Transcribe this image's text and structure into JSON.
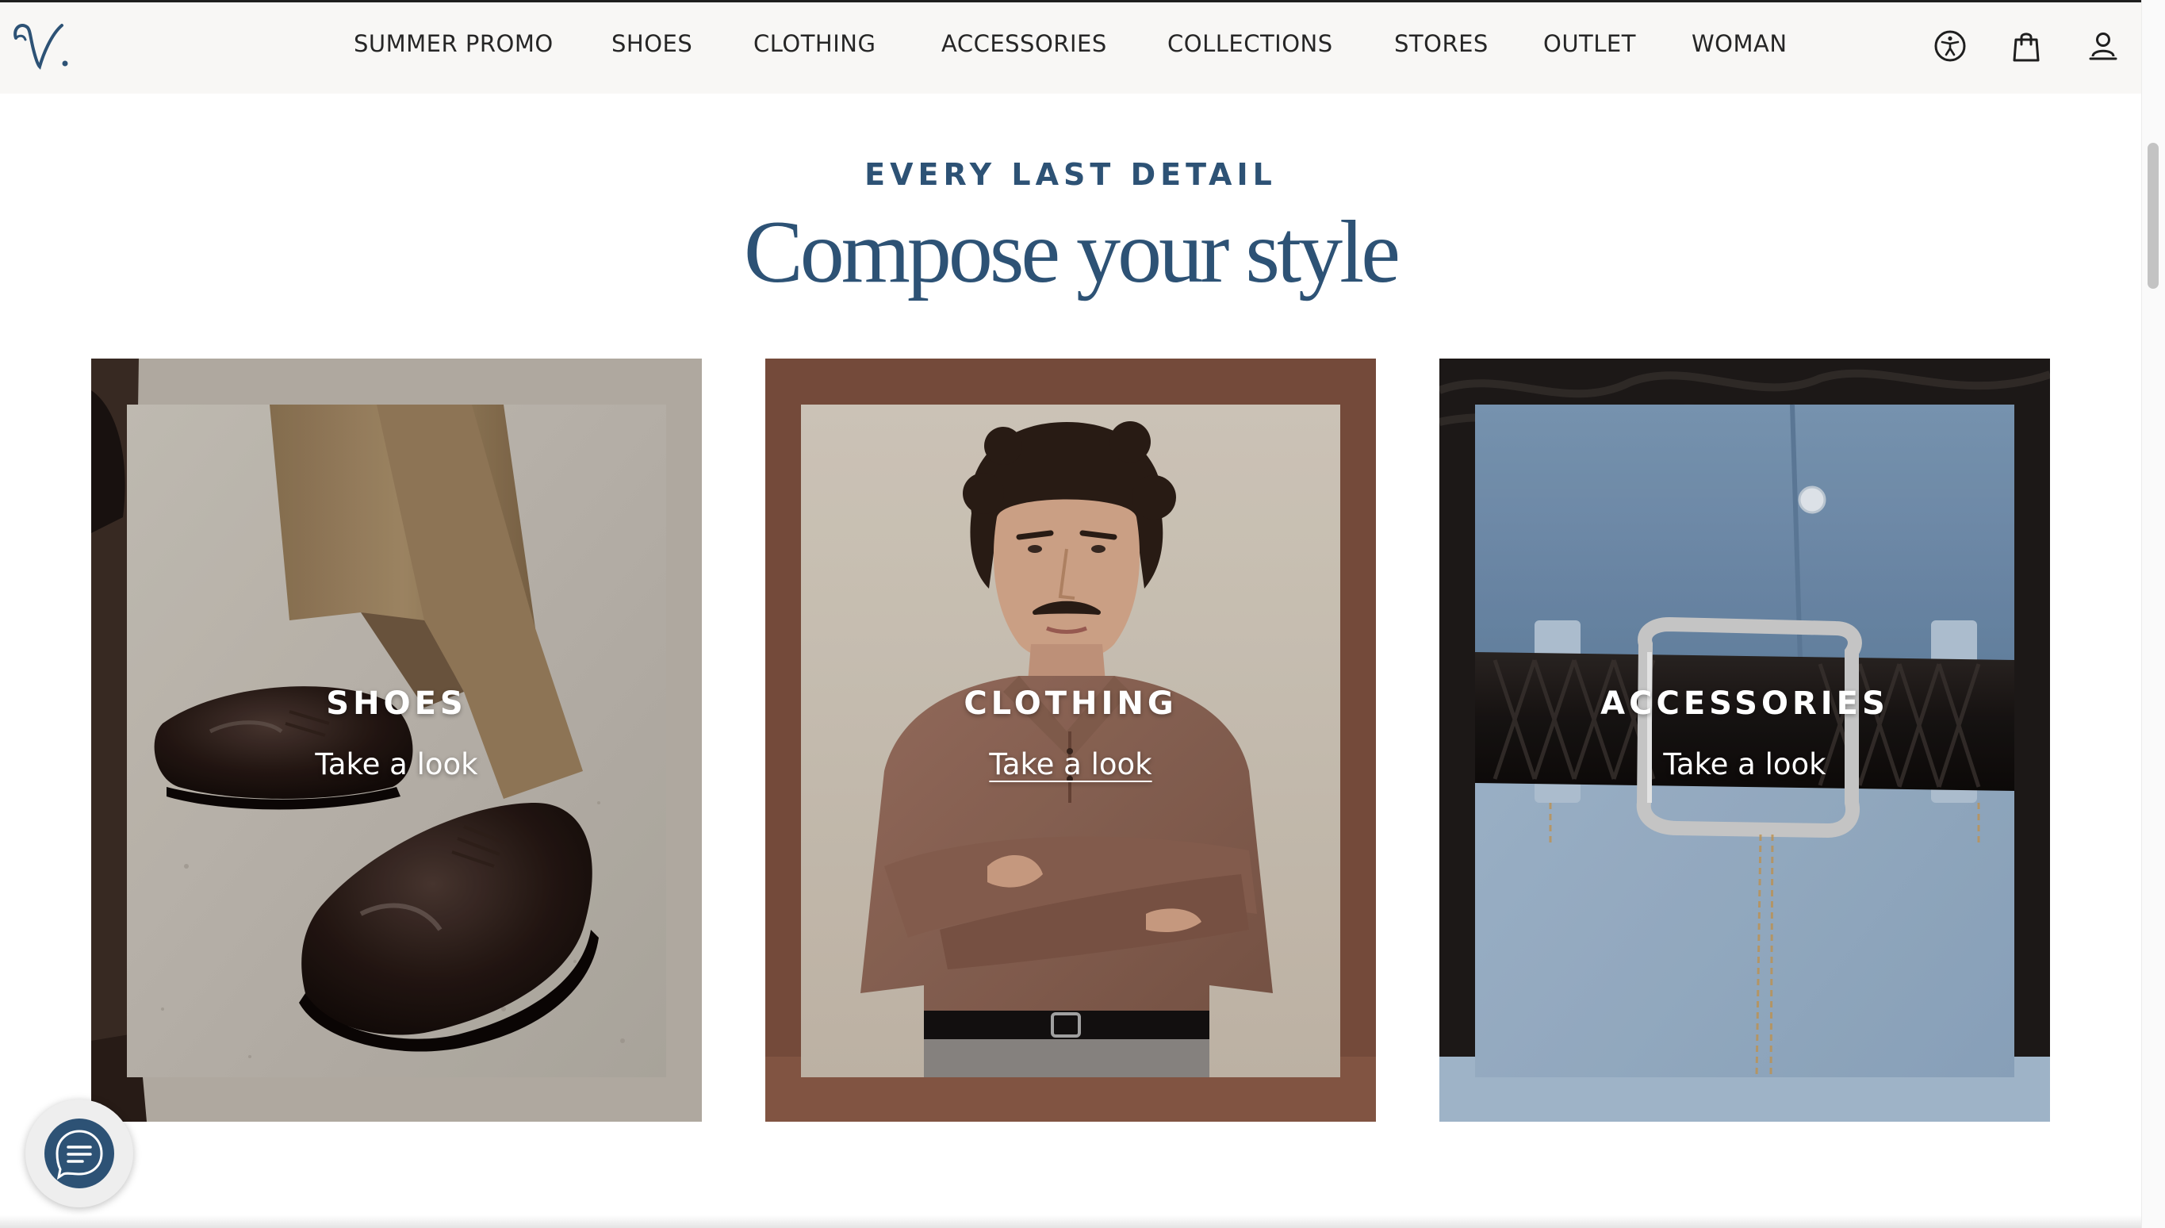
{
  "brand": {
    "logo_text": "V."
  },
  "nav": {
    "items": [
      {
        "label": "SUMMER PROMO"
      },
      {
        "label": "SHOES"
      },
      {
        "label": "CLOTHING"
      },
      {
        "label": "ACCESSORIES"
      },
      {
        "label": "COLLECTIONS"
      },
      {
        "label": "STORES"
      },
      {
        "label": "OUTLET"
      },
      {
        "label": "WOMAN"
      }
    ]
  },
  "utility_icons": [
    "accessibility-icon",
    "shopping-bag-icon",
    "user-account-icon"
  ],
  "section": {
    "eyebrow": "EVERY LAST DETAIL",
    "headline": "Compose your style"
  },
  "cards": [
    {
      "title": "SHOES",
      "link": "Take a look",
      "image": "shoes-photo"
    },
    {
      "title": "CLOTHING",
      "link": "Take a look",
      "image": "clothing-photo"
    },
    {
      "title": "ACCESSORIES",
      "link": "Take a look",
      "image": "accessories-photo"
    }
  ],
  "chat": {
    "icon": "chat-icon"
  },
  "colors": {
    "accent": "#2d5275",
    "nav_bg": "#f8f7f5",
    "nav_text": "#262626",
    "card_link": "#ffffff"
  }
}
